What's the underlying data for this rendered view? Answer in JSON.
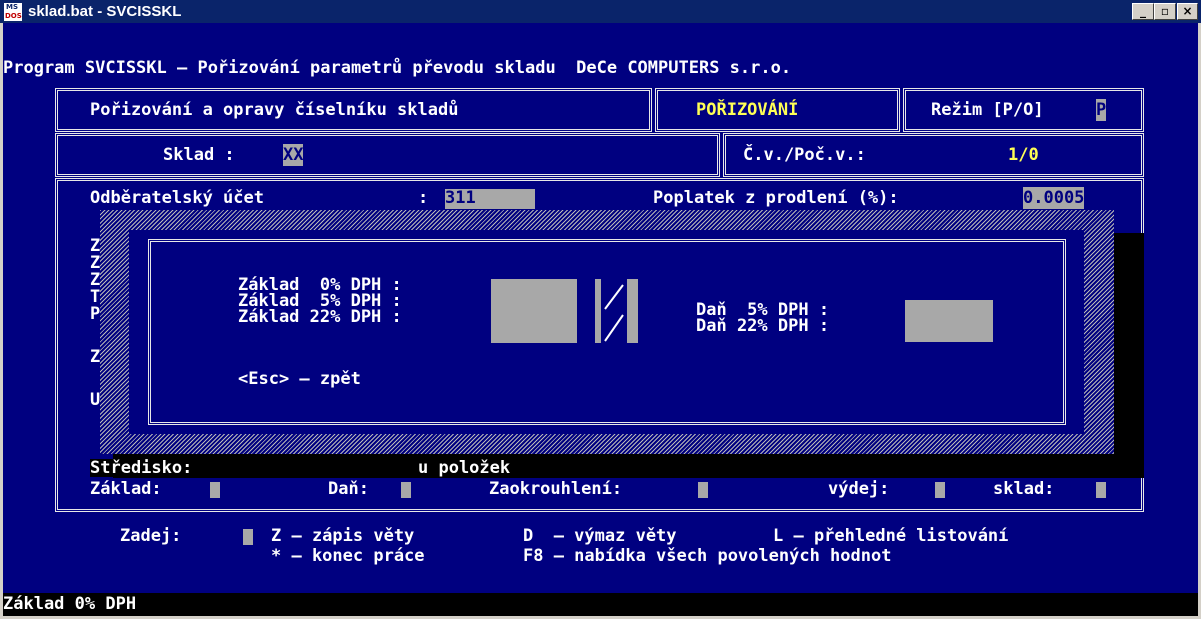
{
  "window": {
    "title": "sklad.bat - SVCISSKL",
    "icon_text_top": "MS",
    "icon_text_bottom": "DOS",
    "minimize": "_",
    "maximize": "▫",
    "close": "×"
  },
  "header_line": "Program SVCISSKL – Pořizování parametrů převodu skladu  DeCe COMPUTERS s.r.o.",
  "panel": {
    "title": "Pořizování a opravy číselníku skladů",
    "mode_label": "POŘIZOVÁNÍ",
    "regime_label": "Režim [P/O]",
    "regime_value": "P",
    "sklad_label": "Sklad :",
    "sklad_value": "XX",
    "cv_label": "Č.v./Poč.v.:",
    "cv_value": "1/0"
  },
  "form": {
    "odberatelsky_label": "Odběratelský účet",
    "odberatelsky_sep": ":",
    "odberatelsky_value": "311",
    "poplatek_label": "Poplatek z prodlení (%):",
    "poplatek_value": "0.0005",
    "left_letters": [
      "Z",
      "Z",
      "Z",
      "T",
      "P",
      "Z",
      "U"
    ],
    "stredisko_label": "Středisko:",
    "polozek_text": "u položek",
    "zaklad_label": "Základ:",
    "dan_label": "Daň:",
    "zaokrouhleni_label": "Zaokrouhlení:",
    "vydej_label": "výdej:",
    "sklad_label": "sklad:"
  },
  "dialog": {
    "zaklad0": "Základ  0% DPH :",
    "zaklad5": "Základ  5% DPH :",
    "zaklad22": "Základ 22% DPH :",
    "dan5": "Daň  5% DPH :",
    "dan22": "Daň 22% DPH :",
    "esc": "<Esc> – zpět"
  },
  "footer": {
    "zadej": "Zadej:",
    "z_cmd": "Z – zápis věty",
    "d_cmd": "D  – výmaz věty",
    "l_cmd": "L – přehledné listování",
    "star_cmd": "* – konec práce",
    "f8_cmd": "F8 – nabídka všech povolených hodnot"
  },
  "status_line": "Základ 0% DPH"
}
